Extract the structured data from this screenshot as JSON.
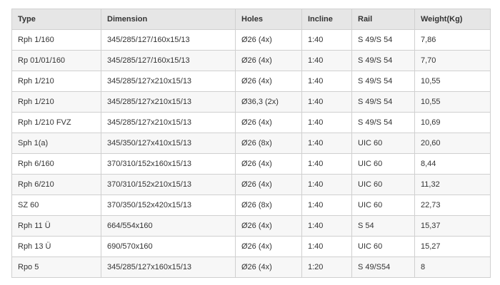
{
  "table": {
    "headers": [
      "Type",
      "Dimension",
      "Holes",
      "Incline",
      "Rail",
      "Weight(Kg)"
    ],
    "rows": [
      [
        "Rph 1/160",
        "345/285/127/160x15/13",
        "Ø26 (4x)",
        "1:40",
        "S 49/S 54",
        "7,86"
      ],
      [
        "Rp 01/01/160",
        "345/285/127/160x15/13",
        "Ø26 (4x)",
        "1:40",
        "S 49/S 54",
        "7,70"
      ],
      [
        "Rph 1/210",
        "345/285/127x210x15/13",
        "Ø26 (4x)",
        "1:40",
        "S 49/S 54",
        "10,55"
      ],
      [
        "Rph 1/210",
        "345/285/127x210x15/13",
        "Ø36,3 (2x)",
        "1:40",
        "S 49/S 54",
        "10,55"
      ],
      [
        "Rph 1/210 FVZ",
        "345/285/127x210x15/13",
        "Ø26 (4x)",
        "1:40",
        "S 49/S 54",
        "10,69"
      ],
      [
        "Sph 1(a)",
        "345/350/127x410x15/13",
        "Ø26 (8x)",
        "1:40",
        "UIC 60",
        "20,60"
      ],
      [
        "Rph 6/160",
        "370/310/152x160x15/13",
        "Ø26 (4x)",
        "1:40",
        "UIC 60",
        "8,44"
      ],
      [
        "Rph 6/210",
        "370/310/152x210x15/13",
        "Ø26 (4x)",
        "1:40",
        "UIC 60",
        "11,32"
      ],
      [
        "SZ 60",
        "370/350/152x420x15/13",
        "Ø26 (8x)",
        "1:40",
        "UIC 60",
        "22,73"
      ],
      [
        "Rph 11 Ü",
        "664/554x160",
        "Ø26 (4x)",
        "1:40",
        "S 54",
        "15,37"
      ],
      [
        "Rph 13 Ü",
        "690/570x160",
        "Ø26 (4x)",
        "1:40",
        "UIC 60",
        "15,27"
      ],
      [
        "Rpo 5",
        "345/285/127x160x15/13",
        "Ø26 (4x)",
        "1:20",
        "S 49/S54",
        "8"
      ]
    ]
  }
}
